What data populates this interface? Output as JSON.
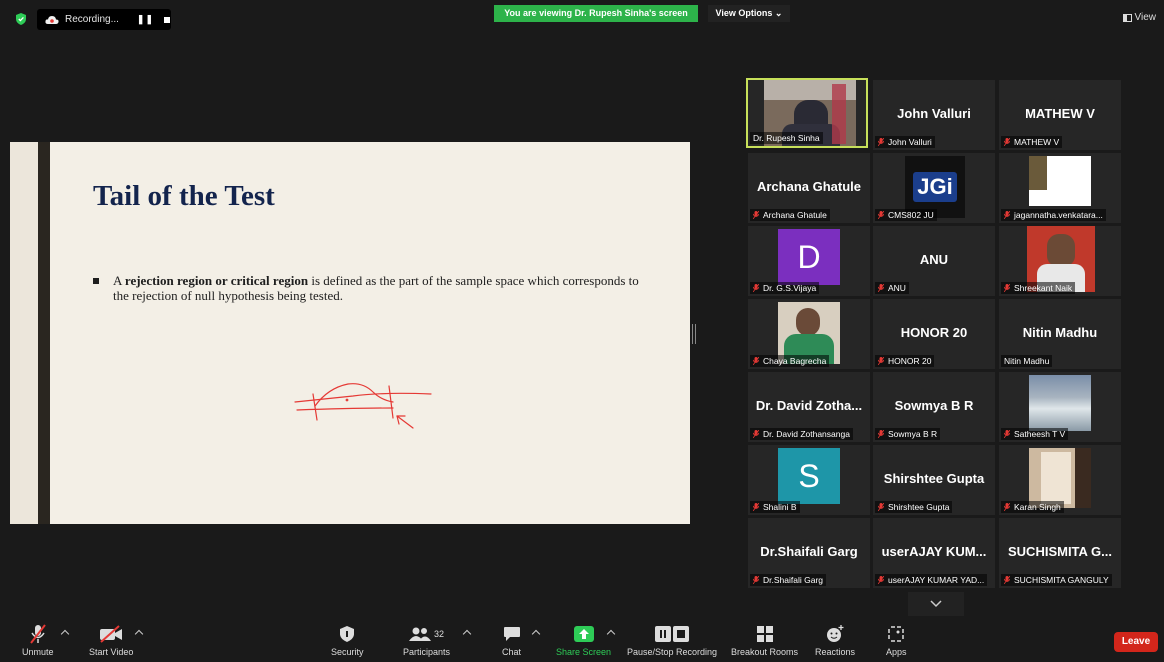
{
  "top_bar": {
    "recording_label": "Recording...",
    "viewing_banner": "You are viewing Dr. Rupesh Sinha's screen",
    "view_options": "View Options ⌄",
    "view_label": "View"
  },
  "slide": {
    "title": "Tail of the Test",
    "bullet_bold": "rejection region or critical region",
    "bullet_prefix": "A ",
    "bullet_rest": " is defined as the part of the sample space which corresponds to the rejection of null hypothesis being tested."
  },
  "gallery": [
    {
      "big": "",
      "label": "Dr. Rupesh Sinha",
      "muted": false
    },
    {
      "big": "John Valluri",
      "label": "John Valluri",
      "muted": true
    },
    {
      "big": "MATHEW V",
      "label": "MATHEW V",
      "muted": true
    },
    {
      "big": "Archana Ghatule",
      "label": "Archana Ghatule",
      "muted": true
    },
    {
      "big": "",
      "label": "CMS802 JU",
      "muted": true,
      "logo": "JGi"
    },
    {
      "big": "",
      "label": "jagannatha.venkatara...",
      "muted": true
    },
    {
      "big": "",
      "label": "Dr. G.S.Vijaya",
      "muted": true,
      "letter": "D"
    },
    {
      "big": "ANU",
      "label": "ANU",
      "muted": true
    },
    {
      "big": "",
      "label": "Shreekant Naik",
      "muted": true
    },
    {
      "big": "",
      "label": "Chaya Bagrecha",
      "muted": true
    },
    {
      "big": "HONOR 20",
      "label": "HONOR 20",
      "muted": true
    },
    {
      "big": "Nitin Madhu",
      "label": "Nitin Madhu",
      "muted": false
    },
    {
      "big": "Dr. David Zotha...",
      "label": "Dr. David Zothansanga",
      "muted": true
    },
    {
      "big": "Sowmya B R",
      "label": "Sowmya B R",
      "muted": true
    },
    {
      "big": "",
      "label": "Satheesh T V",
      "muted": true
    },
    {
      "big": "",
      "label": "Shalini B",
      "muted": true,
      "letter": "S"
    },
    {
      "big": "Shirshtee Gupta",
      "label": "Shirshtee Gupta",
      "muted": true
    },
    {
      "big": "",
      "label": "Karan Singh",
      "muted": true
    },
    {
      "big": "Dr.Shaifali Garg",
      "label": "Dr.Shaifali Garg",
      "muted": true
    },
    {
      "big": "userAJAY KUM...",
      "label": "userAJAY KUMAR YAD...",
      "muted": true
    },
    {
      "big": "SUCHISMITA G...",
      "label": "SUCHISMITA GANGULY",
      "muted": true
    }
  ],
  "toolbar": {
    "unmute": "Unmute",
    "start_video": "Start Video",
    "security": "Security",
    "participants": "Participants",
    "participants_count": "32",
    "chat": "Chat",
    "share_screen": "Share Screen",
    "pause_stop_recording": "Pause/Stop Recording",
    "breakout_rooms": "Breakout Rooms",
    "reactions": "Reactions",
    "apps": "Apps",
    "leave": "Leave"
  },
  "colors": {
    "banner_green": "#2db34a",
    "leave_red": "#d3261b",
    "active_speaker_border": "#c7e05a",
    "slide_title_navy": "#13244d"
  }
}
